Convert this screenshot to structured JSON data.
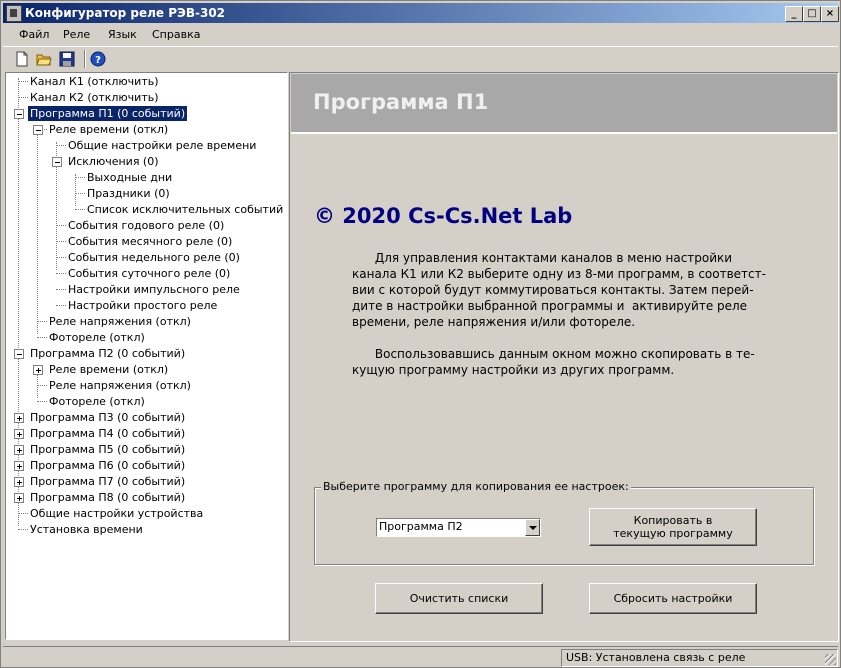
{
  "window": {
    "title": "Конфигуратор реле РЭВ-302",
    "min_label": "_",
    "max_label": "□",
    "close_label": "×"
  },
  "menu": [
    "Файл",
    "Реле",
    "Язык",
    "Справка"
  ],
  "toolbar": [
    "new-file-icon",
    "open-folder-icon",
    "save-icon",
    "help-icon"
  ],
  "tree": [
    "Канал К1 (отключить)",
    "Канал К2 (отключить)",
    "Программа П1 (0 событий)",
    "Реле времени (откл)",
    "Общие настройки реле времени",
    "Исключения (0)",
    "Выходные дни",
    "Праздники (0)",
    "Список исключительных событий (0)",
    "События годового реле (0)",
    "События месячного реле (0)",
    "События недельного реле (0)",
    "События суточного реле (0)",
    "Настройки импульсного реле",
    "Настройки простого реле",
    "Реле напряжения (откл)",
    "Фотореле (откл)",
    "Программа П2 (0 событий)",
    "Реле времени (откл)",
    "Реле напряжения (откл)",
    "Фотореле (откл)",
    "Программа П3 (0 событий)",
    "Программа П4 (0 событий)",
    "Программа П5 (0 событий)",
    "Программа П6 (0 событий)",
    "Программа П7 (0 событий)",
    "Программа П8 (0 событий)",
    "Общие настройки устройства",
    "Установка времени"
  ],
  "panel": {
    "header": "Программа П1",
    "copyright": "© 2020 Cs-Cs.Net Lab",
    "para1": "      Для управления контактами каналов в меню настройки\nканала К1 или К2 выберите одну из 8-ми программ, в соответст-\nвии с которой будут коммутироваться контакты. Затем перей-\nдите в настройки выбранной программы и  активируйте реле\nвремени, реле напряжения и/или фотореле.",
    "para2": "      Воспользовавшись данным окном можно скопировать в те-\nкущую программу настройки из других программ.",
    "group_label": "Выберите программу для копирования ее настроек:",
    "combo_value": "Программа П2",
    "copy_button": "Копировать в\nтекущую программу",
    "clear_button": "Очистить списки",
    "reset_button": "Сбросить настройки"
  },
  "status": "USB: Установлена связь с реле"
}
